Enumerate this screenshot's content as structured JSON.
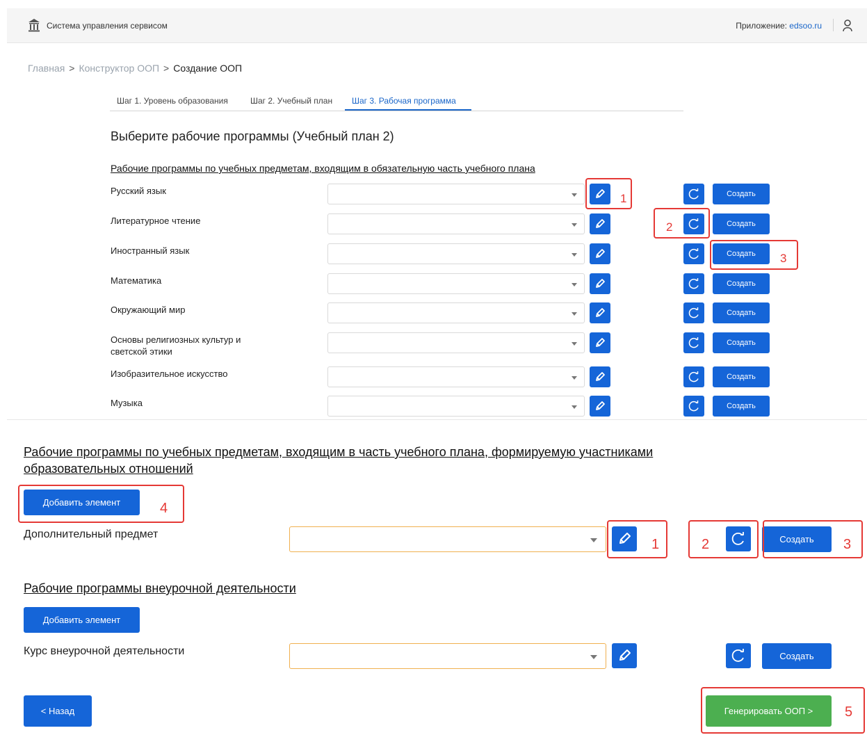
{
  "header": {
    "app_name": "Система управления сервисом",
    "app_label": "Приложение:",
    "app_link": "edsoo.ru",
    "logo_icon": "building-logo-icon",
    "user_icon": "user-icon"
  },
  "breadcrumb": {
    "home": "Главная",
    "constructor": "Конструктор ООП",
    "current": "Создание ООП",
    "separator": ">"
  },
  "tabs": [
    {
      "label": "Шаг 1. Уровень образования"
    },
    {
      "label": "Шаг 2. Учебный план"
    },
    {
      "label": "Шаг 3. Рабочая программа"
    }
  ],
  "page_title": "Выберите рабочие программы (Учебный план 2)",
  "mandatory_section": {
    "title": "Рабочие программы по учебных предметам, входящим в обязательную часть учебного плана",
    "create_label": "Создать",
    "rows": [
      {
        "label": "Русский язык"
      },
      {
        "label": "Литературное чтение"
      },
      {
        "label": "Иностранный язык"
      },
      {
        "label": "Математика"
      },
      {
        "label": "Окружающий мир"
      },
      {
        "label": "Основы религиозных культур и светской этики"
      },
      {
        "label": "Изобразительное искусство"
      },
      {
        "label": "Музыка"
      }
    ]
  },
  "formed_section": {
    "title": "Рабочие программы по учебных предметам, входящим в часть учебного плана, формируемую участниками образовательных отношений",
    "add_label": "Добавить элемент",
    "row_label": "Дополнительный предмет",
    "create_label": "Создать"
  },
  "extracurricular_section": {
    "title": "Рабочие программы внеурочной деятельности",
    "add_label": "Добавить элемент",
    "row_label": "Курс внеурочной деятельности",
    "create_label": "Создать"
  },
  "footer": {
    "back_label": "< Назад",
    "generate_label": "Генерировать ООП >"
  },
  "annotations": [
    "1",
    "2",
    "3",
    "4",
    "5"
  ],
  "colors": {
    "primary": "#1565d8",
    "success": "#4caf50",
    "annotation": "#e53935",
    "warning_border": "#f0b04f"
  }
}
